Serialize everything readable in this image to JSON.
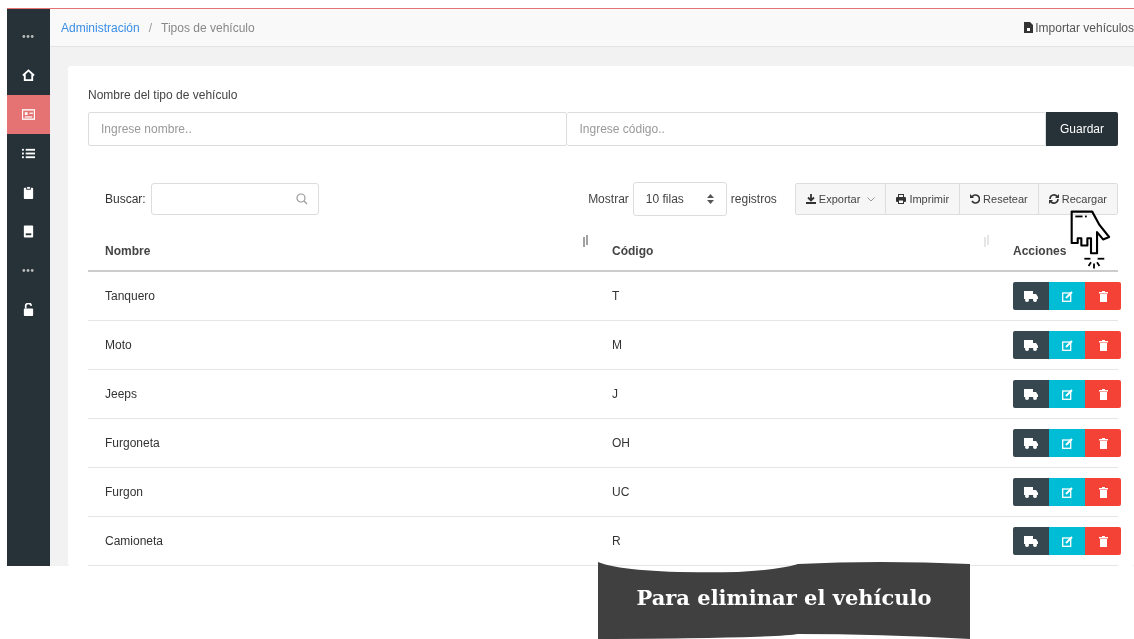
{
  "sidebar": {
    "items": [
      {
        "kind": "dots",
        "selected": false
      },
      {
        "kind": "home",
        "selected": false
      },
      {
        "kind": "card",
        "selected": true
      },
      {
        "kind": "list",
        "selected": false
      },
      {
        "kind": "clipboard",
        "selected": false
      },
      {
        "kind": "book",
        "selected": false
      },
      {
        "kind": "dots",
        "selected": false
      },
      {
        "kind": "lock",
        "selected": false
      }
    ]
  },
  "breadcrumb": [
    {
      "label": "Administración",
      "link": true
    },
    {
      "label": "Tipos de vehículo",
      "link": false
    }
  ],
  "breadcrumb_separator": "/",
  "header_action": "Importar vehículos",
  "form": {
    "label": "Nombre del tipo de vehículo",
    "name_placeholder": "Ingrese nombre..",
    "code_placeholder": "Ingrese código..",
    "save": "Guardar"
  },
  "search": {
    "label": "Buscar:"
  },
  "length": {
    "before": "Mostrar",
    "value": "10 filas",
    "after": "registros"
  },
  "toolbar": [
    {
      "kind": "export",
      "label": "Exportar"
    },
    {
      "kind": "print",
      "label": "Imprimir"
    },
    {
      "kind": "reset",
      "label": "Resetear"
    },
    {
      "kind": "reload",
      "label": "Recargar"
    }
  ],
  "table": {
    "columns": [
      "Nombre",
      "Código",
      "Acciones"
    ],
    "rows": [
      {
        "name": "Tanquero",
        "code": "T"
      },
      {
        "name": "Moto",
        "code": "M"
      },
      {
        "name": "Jeeps",
        "code": "J"
      },
      {
        "name": "Furgoneta",
        "code": "OH"
      },
      {
        "name": "Furgon",
        "code": "UC"
      },
      {
        "name": "Camioneta",
        "code": "R"
      }
    ]
  },
  "caption": "Para eliminar el vehículo"
}
